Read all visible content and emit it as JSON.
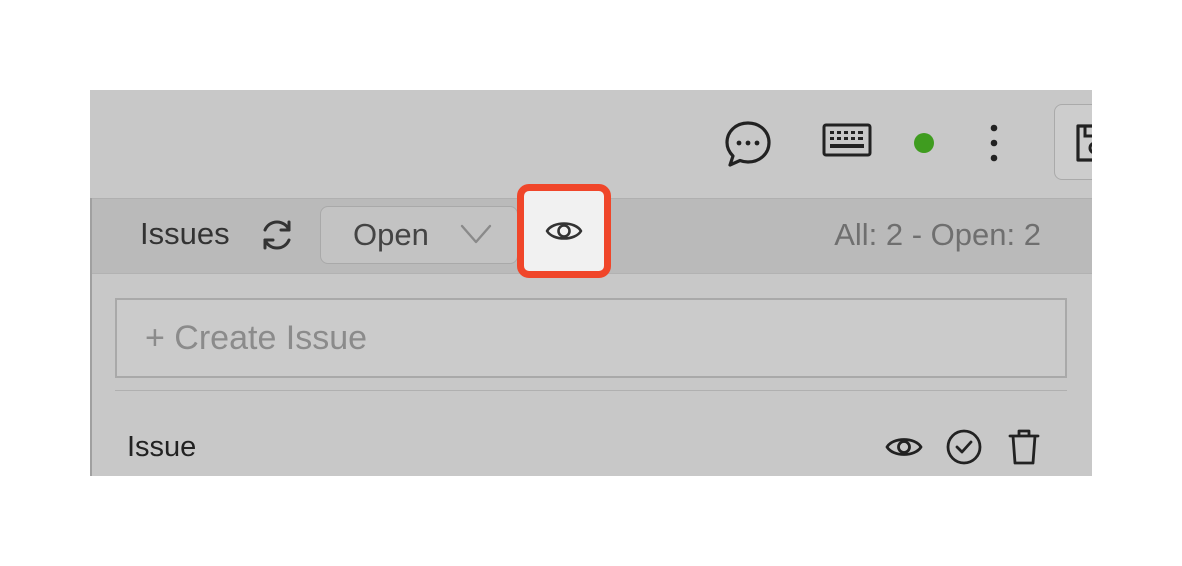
{
  "toolbar": {
    "title": "Issues",
    "filter": {
      "selected": "Open"
    },
    "counts": "All: 2 - Open: 2"
  },
  "create": {
    "placeholder": "+ Create Issue"
  },
  "issues": [
    {
      "label": "Issue"
    }
  ],
  "icons": {
    "topbar": [
      "chat-bubble-icon",
      "keyboard-icon",
      "status-dot",
      "more-vertical-icon",
      "save-icon"
    ],
    "toolbar": [
      "refresh-icon",
      "chevron-down-icon",
      "eye-icon"
    ],
    "issue_row": [
      "eye-icon",
      "check-circle-icon",
      "trash-icon"
    ]
  },
  "colors": {
    "status_online": "#3f9c1f",
    "highlight": "#f0462a"
  }
}
